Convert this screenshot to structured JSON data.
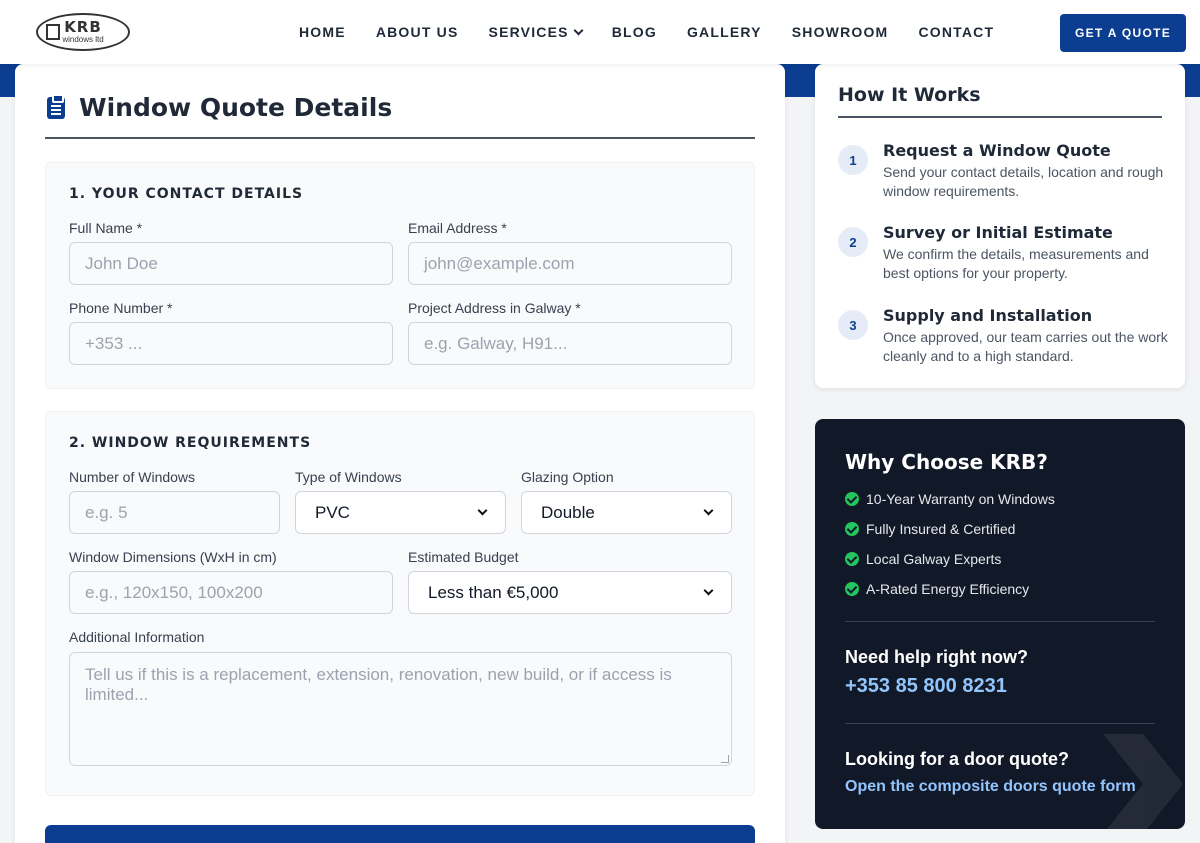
{
  "header": {
    "logo": {
      "main": "KRB",
      "sub": "windows ltd"
    },
    "nav": [
      "HOME",
      "ABOUT US",
      "SERVICES",
      "BLOG",
      "GALLERY",
      "SHOWROOM",
      "CONTACT"
    ],
    "cta": "GET A QUOTE"
  },
  "form": {
    "title": "Window Quote Details",
    "section1": {
      "title": "1. YOUR CONTACT DETAILS",
      "full_name": {
        "label": "Full Name *",
        "placeholder": "John Doe",
        "value": ""
      },
      "email": {
        "label": "Email Address *",
        "placeholder": "john@example.com",
        "value": ""
      },
      "phone": {
        "label": "Phone Number *",
        "placeholder": "+353 ...",
        "value": ""
      },
      "address": {
        "label": "Project Address in Galway *",
        "placeholder": "e.g. Galway, H91...",
        "value": ""
      }
    },
    "section2": {
      "title": "2. WINDOW REQUIREMENTS",
      "num_windows": {
        "label": "Number of Windows",
        "placeholder": "e.g. 5",
        "value": ""
      },
      "type": {
        "label": "Type of Windows",
        "selected": "PVC"
      },
      "glazing": {
        "label": "Glazing Option",
        "selected": "Double"
      },
      "dimensions": {
        "label": "Window Dimensions (WxH in cm)",
        "placeholder": "e.g., 120x150, 100x200",
        "value": ""
      },
      "budget": {
        "label": "Estimated Budget",
        "selected": "Less than €5,000"
      },
      "additional": {
        "label": "Additional Information",
        "placeholder": "Tell us if this is a replacement, extension, renovation, new build, or if access is limited...",
        "value": ""
      }
    }
  },
  "how_it_works": {
    "title": "How It Works",
    "steps": [
      {
        "num": "1",
        "title": "Request a Window Quote",
        "text": "Send your contact details, location and rough window requirements."
      },
      {
        "num": "2",
        "title": "Survey or Initial Estimate",
        "text": "We confirm the details, measurements and best options for your property."
      },
      {
        "num": "3",
        "title": "Supply and Installation",
        "text": "Once approved, our team carries out the work cleanly and to a high standard."
      }
    ]
  },
  "why": {
    "title": "Why Choose KRB?",
    "items": [
      "10-Year Warranty on Windows",
      "Fully Insured & Certified",
      "Local Galway Experts",
      "A-Rated Energy Efficiency"
    ],
    "help_title": "Need help right now?",
    "phone": "+353 85 800 8231",
    "door_title": "Looking for a door quote?",
    "door_link": "Open the composite doors quote form"
  },
  "colors": {
    "brand": "#0b3d91",
    "dark_panel": "#111827",
    "check": "#22c55e",
    "link": "#93c5fd"
  }
}
